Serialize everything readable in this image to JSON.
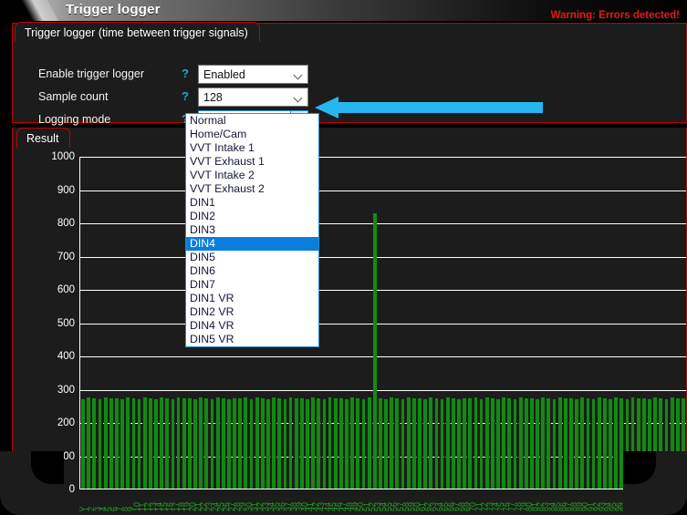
{
  "window": {
    "title": "Trigger logger",
    "warning": "Warning: Errors detected!"
  },
  "tabs": {
    "settings_tab": "Trigger logger (time between trigger signals)",
    "result_tab": "Result"
  },
  "form": {
    "help_glyph": "?",
    "rows": [
      {
        "label": "Enable trigger logger",
        "value": "Enabled"
      },
      {
        "label": "Sample count",
        "value": "128"
      },
      {
        "label": "Logging mode",
        "value": "Normal"
      }
    ]
  },
  "dropdown": {
    "open": true,
    "selected": "DIN4",
    "options": [
      "Normal",
      "Home/Cam",
      "VVT Intake 1",
      "VVT Exhaust 1",
      "VVT Intake 2",
      "VVT Exhaust 2",
      "DIN1",
      "DIN2",
      "DIN3",
      "DIN4",
      "DIN5",
      "DIN6",
      "DIN7",
      "DIN1 VR",
      "DIN2 VR",
      "DIN4 VR",
      "DIN5 VR"
    ]
  },
  "annotation": {
    "arrow_color": "#27b6f0",
    "points_to": "logging-mode-dropdown-arrow"
  },
  "colors": {
    "accent_red": "#c00000",
    "bar_green": "#128a12",
    "highlight_blue": "#0a7ddd",
    "help_teal": "#1ea9c9",
    "warning_red": "#e31a1a"
  },
  "chart_data": {
    "type": "bar",
    "title": "",
    "xlabel": "",
    "ylabel": "",
    "ylim": [
      0,
      1000
    ],
    "ytick_labels": [
      "1000",
      "900",
      "800",
      "700",
      "600",
      "500",
      "400",
      "300",
      "200",
      "100",
      "0"
    ],
    "yticks": [
      1000,
      900,
      800,
      700,
      600,
      500,
      400,
      300,
      200,
      100,
      0
    ],
    "grid": true,
    "legend": "none",
    "categories": [
      "0",
      "1",
      "2",
      "3",
      "4",
      "5",
      "6",
      "7",
      "8",
      "9",
      "10",
      "11",
      "12",
      "13",
      "14",
      "15",
      "16",
      "17",
      "18",
      "19",
      "20",
      "21",
      "22",
      "23",
      "24",
      "25",
      "26",
      "27",
      "28",
      "29",
      "30",
      "31",
      "32",
      "33",
      "34",
      "35",
      "36",
      "37",
      "38",
      "39",
      "40",
      "41",
      "42",
      "43",
      "44",
      "45",
      "46",
      "47",
      "48",
      "49",
      "50",
      "51",
      "52",
      "53",
      "54",
      "55",
      "56",
      "57",
      "58",
      "59",
      "60",
      "61",
      "62",
      "63",
      "64",
      "65",
      "66",
      "67",
      "68",
      "69",
      "70",
      "71",
      "72",
      "73",
      "74",
      "75",
      "76",
      "77",
      "78",
      "79",
      "80",
      "81",
      "82",
      "83",
      "84",
      "85",
      "86",
      "87",
      "88",
      "89",
      "90",
      "91",
      "92",
      "93",
      "94",
      "95",
      "96",
      "97",
      "98",
      "99",
      "100",
      "101",
      "102",
      "103",
      "104",
      "105",
      "106",
      "107"
    ],
    "values": [
      272,
      276,
      274,
      270,
      277,
      273,
      275,
      271,
      276,
      274,
      272,
      278,
      273,
      270,
      276,
      274,
      271,
      277,
      273,
      275,
      272,
      276,
      274,
      271,
      277,
      273,
      270,
      275,
      274,
      276,
      272,
      278,
      273,
      271,
      276,
      274,
      270,
      277,
      273,
      275,
      272,
      276,
      274,
      271,
      277,
      273,
      275,
      271,
      276,
      274,
      272,
      278,
      830,
      273,
      270,
      276,
      274,
      271,
      277,
      273,
      275,
      272,
      276,
      274,
      271,
      277,
      273,
      270,
      275,
      274,
      276,
      272,
      278,
      273,
      271,
      276,
      274,
      270,
      277,
      273,
      275,
      272,
      276,
      274,
      271,
      277,
      273,
      275,
      271,
      276,
      274,
      272,
      278,
      273,
      270,
      276,
      274,
      271,
      277,
      273,
      275,
      272,
      276,
      274,
      271,
      277,
      273,
      275
    ],
    "spike_index": 52,
    "spike_value": 830
  }
}
